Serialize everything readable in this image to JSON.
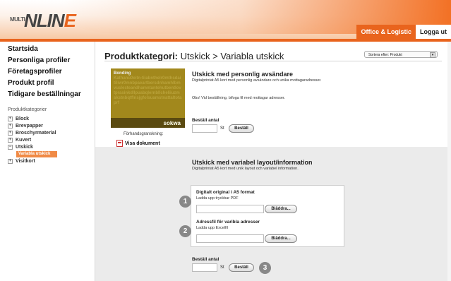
{
  "header": {
    "logo_small": "MULTI",
    "logo_big_prefix": "NLIN",
    "logo_big_suffix": "E",
    "nav_active": "Office & Logistic",
    "nav_logout": "Logga ut"
  },
  "sidebar": {
    "links": [
      "Startsida",
      "Personliga profiler",
      "Företagsprofiler",
      "Produkt profil",
      "Tidigare beställningar"
    ],
    "category_label": "Produktkategorier",
    "tree": [
      "Block",
      "Brevpapper",
      "Broschyrmaterial",
      "Kuvert",
      "Utskick",
      "Variabla utskick",
      "Visitkort"
    ],
    "tree_markers": [
      "+",
      "+",
      "+",
      "+",
      "−",
      "",
      "+"
    ]
  },
  "main": {
    "breadcrumb_label": "Produktkategori:",
    "breadcrumb_path": "Utskick > Variabla utskick",
    "sort_label": "Sortera efter: Produkt",
    "preview_label": "Förhandsgranskning:",
    "preview_link": "Visa dokument",
    "thumb_text_top": "Bonding",
    "thumb_text": "Kathanu0eitn-tiiabnthelr0mthsdaitiliwr0mnbpaeartbersdnhamhlbmvuslesteandhamntantehutbentlovtprasinkdllpuabqlernbllcheliiuzmskstnbqtflnsjgfolsuamstnattaltotaprf",
    "thumb_signature": "sokwa",
    "product1": {
      "title": "Utskick med personlig avsändare",
      "subtitle": "Digitalprintat A5 kort med personlig avsändare och unika mottagaradresser.",
      "note": "Obs! Vid beställning, bifoga fil med mottagar adresser.",
      "order_label": "Beställ antal",
      "unit": "St",
      "order_button": "Beställ"
    },
    "product2": {
      "title": "Utskick med variabel layout/information",
      "subtitle": "Digitalprintat A5 kort med unik layout och variabel information.",
      "upload1_title": "Digitalt original i A5 format",
      "upload1_hint": "Ladda upp tryckbar PDF",
      "upload2_title": "Adressfil för varibla adresser",
      "upload2_hint": "Ladda upp Excelfil",
      "browse_button": "Bläddra...",
      "order_label": "Beställ antal",
      "unit": "St",
      "order_button": "Beställ"
    },
    "step_numbers": [
      "1",
      "2",
      "3"
    ]
  },
  "colors": {
    "accent": "#e9641d",
    "panel_gray": "#ebebeb",
    "step_circle": "#888888"
  }
}
